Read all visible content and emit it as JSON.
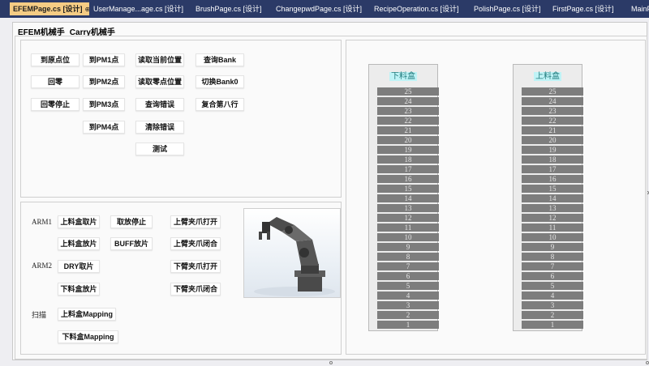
{
  "tabs": [
    {
      "label": "EFEMPage.cs [设计]",
      "active": true
    },
    {
      "label": "UserManage...age.cs [设计]",
      "active": false
    },
    {
      "label": "BrushPage.cs [设计]",
      "active": false
    },
    {
      "label": "ChangepwdPage.cs [设计]",
      "active": false
    },
    {
      "label": "RecipeOperation.cs [设计]",
      "active": false
    },
    {
      "label": "PolishPage.cs [设计]",
      "active": false
    },
    {
      "label": "FirstPage.cs [设计]",
      "active": false
    },
    {
      "label": "MainFo",
      "active": false
    }
  ],
  "tab_icons": {
    "pin": "⊕",
    "close": "×"
  },
  "form": {
    "tab_headers": [
      "EFEM机械手",
      "Carry机械手"
    ]
  },
  "top_panel": {
    "buttons": [
      "到原点位",
      "到PM1点",
      "读取当前位置",
      "查询Bank",
      "回零",
      "到PM2点",
      "读取零点位置",
      "切换Bank0",
      "回零停止",
      "到PM3点",
      "查询错误",
      "复合第八行",
      "到PM4点",
      "清除错误",
      "测试"
    ]
  },
  "bottom_panel": {
    "labels": [
      "ARM1",
      "ARM2",
      "扫描"
    ],
    "buttons": [
      "上料盒取片",
      "取放停止",
      "上臂夹爪打开",
      "上料盒放片",
      "BUFF放片",
      "上臂夹爪闭合",
      "DRY取片",
      "下臂夹爪打开",
      "下料盒放片",
      "下臂夹爪闭合",
      "上料盒Mapping",
      "下料盒Mapping"
    ]
  },
  "cassettes": [
    {
      "title": "下料盒",
      "slots": [
        "25",
        "24",
        "23",
        "22",
        "21",
        "20",
        "19",
        "18",
        "17",
        "16",
        "15",
        "14",
        "13",
        "12",
        "11",
        "10",
        "9",
        "8",
        "7",
        "6",
        "5",
        "4",
        "3",
        "2",
        "1"
      ]
    },
    {
      "title": "上料盒",
      "slots": [
        "25",
        "24",
        "23",
        "22",
        "21",
        "20",
        "19",
        "18",
        "17",
        "16",
        "15",
        "14",
        "13",
        "12",
        "11",
        "10",
        "9",
        "8",
        "7",
        "6",
        "5",
        "4",
        "3",
        "2",
        "1"
      ]
    }
  ],
  "colors": {
    "tab_strip": "#2b3a67",
    "active_tab": "#f5cc84",
    "slot": "#7d7d7d",
    "cassette_title_bg": "#bff3f6"
  }
}
